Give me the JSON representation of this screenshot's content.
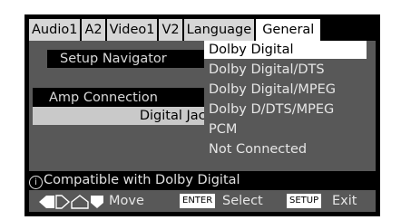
{
  "tabs": [
    {
      "label": "Audio1",
      "active": false
    },
    {
      "label": "A2",
      "active": false
    },
    {
      "label": "Video1",
      "active": false
    },
    {
      "label": "V2",
      "active": false
    },
    {
      "label": "Language",
      "active": false
    },
    {
      "label": "General",
      "active": true
    }
  ],
  "settings": {
    "setup_navigator": "Setup Navigator",
    "amp_connection": "Amp Connection",
    "digital_jack": "Digital Jack"
  },
  "dropdown": {
    "options": [
      "Dolby Digital",
      "Dolby Digital/DTS",
      "Dolby Digital/MPEG",
      "Dolby D/DTS/MPEG",
      "PCM",
      "Not Connected"
    ],
    "selected_index": 0
  },
  "info": {
    "icon_glyph": "i",
    "text": "Compatible with Dolby Digital"
  },
  "footer": {
    "move_label": "Move",
    "enter_key": "ENTER",
    "select_label": "Select",
    "setup_key": "SETUP",
    "exit_label": "Exit"
  },
  "icons": {
    "navigation_arrows": "left-right-up-down-arrows-icon",
    "info": "info-icon"
  },
  "colors": {
    "frame": "#000000",
    "panel": "#585858",
    "highlight": "#ffffff",
    "tab": "#d6d6d6",
    "field_highlight": "#c9c9c9"
  }
}
